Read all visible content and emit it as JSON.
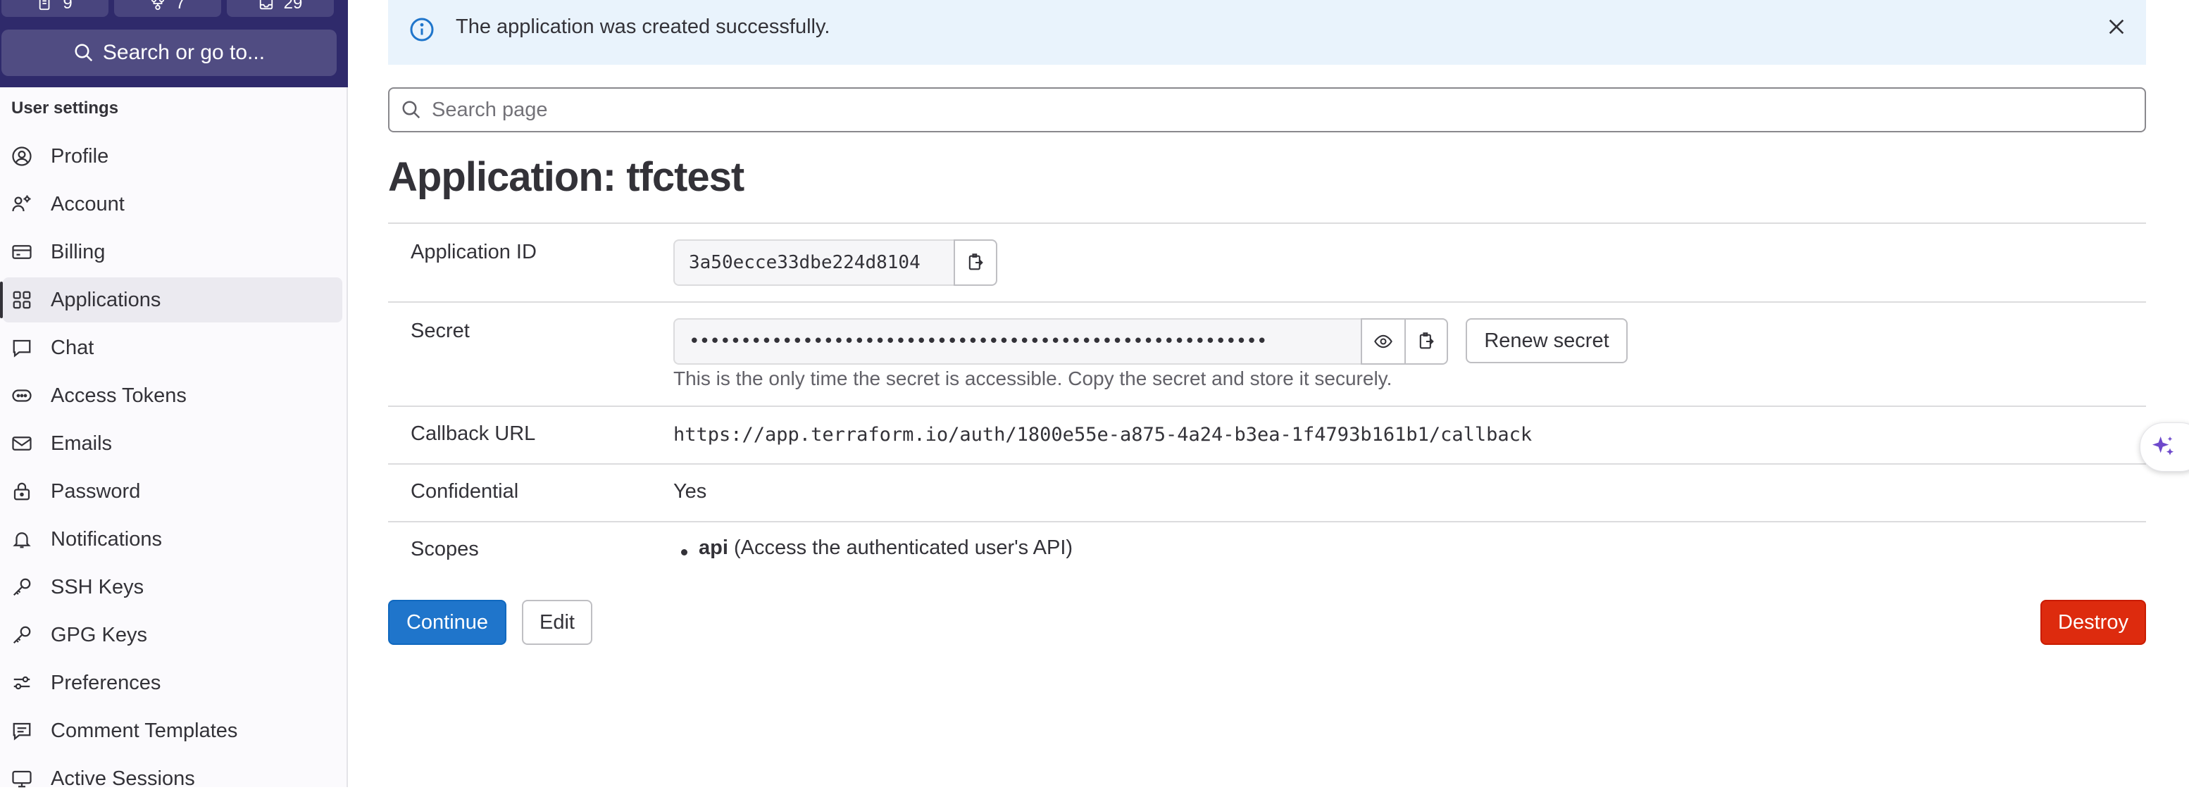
{
  "sidebar": {
    "counters": [
      {
        "icon": "merge-request-icon",
        "count": "9"
      },
      {
        "icon": "issues-icon",
        "count": "7"
      },
      {
        "icon": "todo-icon",
        "count": "29"
      }
    ],
    "search_label": "Search or go to...",
    "section_title": "User settings",
    "items": [
      {
        "label": "Profile",
        "icon": "profile-icon"
      },
      {
        "label": "Account",
        "icon": "account-icon"
      },
      {
        "label": "Billing",
        "icon": "billing-icon"
      },
      {
        "label": "Applications",
        "icon": "applications-icon",
        "active": true
      },
      {
        "label": "Chat",
        "icon": "chat-icon"
      },
      {
        "label": "Access Tokens",
        "icon": "token-icon"
      },
      {
        "label": "Emails",
        "icon": "mail-icon"
      },
      {
        "label": "Password",
        "icon": "lock-icon"
      },
      {
        "label": "Notifications",
        "icon": "bell-icon"
      },
      {
        "label": "SSH Keys",
        "icon": "key-icon"
      },
      {
        "label": "GPG Keys",
        "icon": "key-icon"
      },
      {
        "label": "Preferences",
        "icon": "preferences-icon"
      },
      {
        "label": "Comment Templates",
        "icon": "comment-icon"
      },
      {
        "label": "Active Sessions",
        "icon": "monitor-icon"
      }
    ]
  },
  "alert": {
    "message": "The application was created successfully."
  },
  "page_search": {
    "placeholder": "Search page"
  },
  "application": {
    "title": "Application: tfctest",
    "fields": {
      "application_id": {
        "label": "Application ID",
        "value": "3a50ecce33dbe224d8104"
      },
      "secret": {
        "label": "Secret",
        "masked_value": "••••••••••••••••••••••••••••••••••••••••••••••••••••••••",
        "renew_label": "Renew secret",
        "help": "This is the only time the secret is accessible. Copy the secret and store it securely."
      },
      "callback_url": {
        "label": "Callback URL",
        "value": "https://app.terraform.io/auth/1800e55e-a875-4a24-b3ea-1f4793b161b1/callback"
      },
      "confidential": {
        "label": "Confidential",
        "value": "Yes"
      },
      "scopes": {
        "label": "Scopes",
        "items": [
          {
            "name": "api",
            "description": "(Access the authenticated user's API)"
          }
        ]
      }
    }
  },
  "actions": {
    "continue_label": "Continue",
    "edit_label": "Edit",
    "destroy_label": "Destroy"
  },
  "colors": {
    "sidebar_header": "#2f2a6b",
    "alert_bg": "#e9f3fc",
    "confirm": "#1f75cb",
    "danger": "#dd2b0e",
    "duo_accent": "#6e49cb"
  }
}
